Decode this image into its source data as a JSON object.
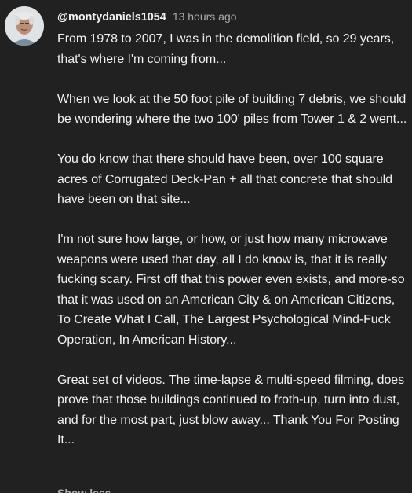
{
  "comment": {
    "author": "@montydaniels1054",
    "timestamp": "13 hours ago",
    "paragraphs": [
      "From 1978 to 2007, I was in the demolition field, so 29 years, that's where I'm coming from...",
      "When we look at the 50 foot pile of building 7 debris, we should be wondering where the two 100' piles from Tower 1 & 2 went...",
      "You do know that there should have been, over 100 square acres of Corrugated Deck-Pan + all that concrete that should have been on that site...",
      "I'm not sure how large, or how, or just how many microwave weapons were used that day, all I do know is, that it is really fucking scary. First off that this power even exists, and more-so that it was used on an American City & on American Citizens, To Create What I Call, The Largest Psychological Mind-Fuck Operation, In American History...",
      "Great set of videos. The time-lapse & multi-speed filming, does prove that those buildings continued to froth-up, turn into dust, and for the most part, just blow away... Thank You For Posting It..."
    ],
    "show_less_label": "Show less"
  },
  "colors": {
    "background": "#212121",
    "text": "#f1f1f1",
    "secondary": "#aaaaaa"
  },
  "icons": {
    "avatar": "user-avatar-photo"
  }
}
